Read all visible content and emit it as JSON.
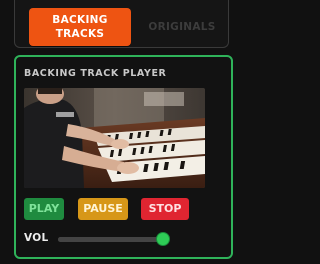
{
  "tabs": [
    {
      "label": "BACKING\nTRACKS",
      "active": true
    },
    {
      "label": "ORIGINALS",
      "active": false
    }
  ],
  "player": {
    "title": "BACKING TRACK PLAYER",
    "video_description": "musician-playing-organ",
    "buttons": {
      "play": "PLAY",
      "pause": "PAUSE",
      "stop": "STOP"
    },
    "volume": {
      "label": "VOL",
      "level": 0.98
    }
  },
  "colors": {
    "accent": "#ee5412",
    "panel_border": "#2fb35a",
    "play": "#1f8b3f",
    "pause": "#d79718",
    "stop": "#e02531",
    "slider_thumb": "#2ecc56"
  }
}
